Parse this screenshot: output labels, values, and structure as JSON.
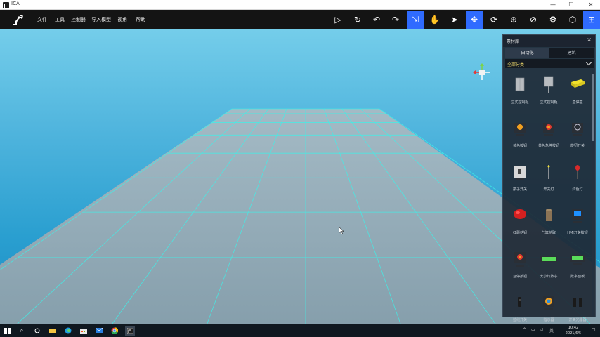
{
  "window": {
    "title": "ICA",
    "minimize_glyph": "—",
    "maximize_glyph": "☐",
    "close_glyph": "✕"
  },
  "menu": [
    {
      "label": "文件"
    },
    {
      "label": "工具"
    },
    {
      "label": "控制器"
    },
    {
      "label": "导入模型"
    },
    {
      "label": "视角"
    },
    {
      "label": "帮助"
    }
  ],
  "toolbar": {
    "icons": [
      {
        "name": "play-icon",
        "glyph": "▷"
      },
      {
        "name": "reset-icon",
        "glyph": "↻"
      },
      {
        "name": "undo-icon",
        "glyph": "↶"
      },
      {
        "name": "redo-icon",
        "glyph": "↷"
      },
      {
        "name": "select-icon",
        "glyph": "⇲",
        "active": true
      },
      {
        "name": "hand-icon",
        "glyph": "✋"
      },
      {
        "name": "pointer-icon",
        "glyph": "➤"
      },
      {
        "name": "move-icon",
        "glyph": "✥",
        "active": true
      },
      {
        "name": "rotate-icon",
        "glyph": "⟳"
      },
      {
        "name": "crosshair-icon",
        "glyph": "⊕"
      },
      {
        "name": "globe-icon",
        "glyph": "⊘"
      },
      {
        "name": "gear-icon",
        "glyph": "⚙"
      },
      {
        "name": "cube-icon",
        "glyph": "⬡"
      },
      {
        "name": "grid-icon",
        "glyph": "⊞",
        "active": true
      }
    ]
  },
  "panel": {
    "title": "素材库",
    "close_glyph": "×",
    "tabs": [
      {
        "label": "自动化",
        "active": true
      },
      {
        "label": "建筑",
        "active": false
      }
    ],
    "category": "全部分类",
    "items": [
      {
        "label": "立式控制柜",
        "kind": "cabinet"
      },
      {
        "label": "立式控制柜",
        "kind": "cabinet-stand"
      },
      {
        "label": "急停盒",
        "kind": "yellow-box"
      },
      {
        "label": "黄色按钮",
        "kind": "button-yellow"
      },
      {
        "label": "黄色急停按钮",
        "kind": "button-red"
      },
      {
        "label": "旋钮开关",
        "kind": "knob"
      },
      {
        "label": "拨子开关",
        "kind": "toggle"
      },
      {
        "label": "开关灯",
        "kind": "lamp-pole"
      },
      {
        "label": "红色灯",
        "kind": "lamp-red"
      },
      {
        "label": "红蘑菇钮",
        "kind": "mushroom"
      },
      {
        "label": "气缸拾取",
        "kind": "cylinder"
      },
      {
        "label": "HMI开关按钮",
        "kind": "hmi-blue"
      },
      {
        "label": "急停按钮",
        "kind": "estop"
      },
      {
        "label": "大小灯数字",
        "kind": "bar-green"
      },
      {
        "label": "数字面板",
        "kind": "panel-green"
      },
      {
        "label": "拉线开关",
        "kind": "pull"
      },
      {
        "label": "指示器",
        "kind": "gauge"
      },
      {
        "label": "开关光栅器",
        "kind": "sensor"
      }
    ]
  },
  "taskbar": {
    "search_glyph": "⌕",
    "tray_text": "英",
    "clock_time": "10:42",
    "clock_date": "2021/6/5"
  },
  "colors": {
    "toolbar_bg": "#141414",
    "accent": "#2f6bff",
    "sky_top": "#74cdea",
    "sky_bottom": "#1b8cc4",
    "floor": "#8fa9b7",
    "grid_line": "#3ff0e8"
  }
}
